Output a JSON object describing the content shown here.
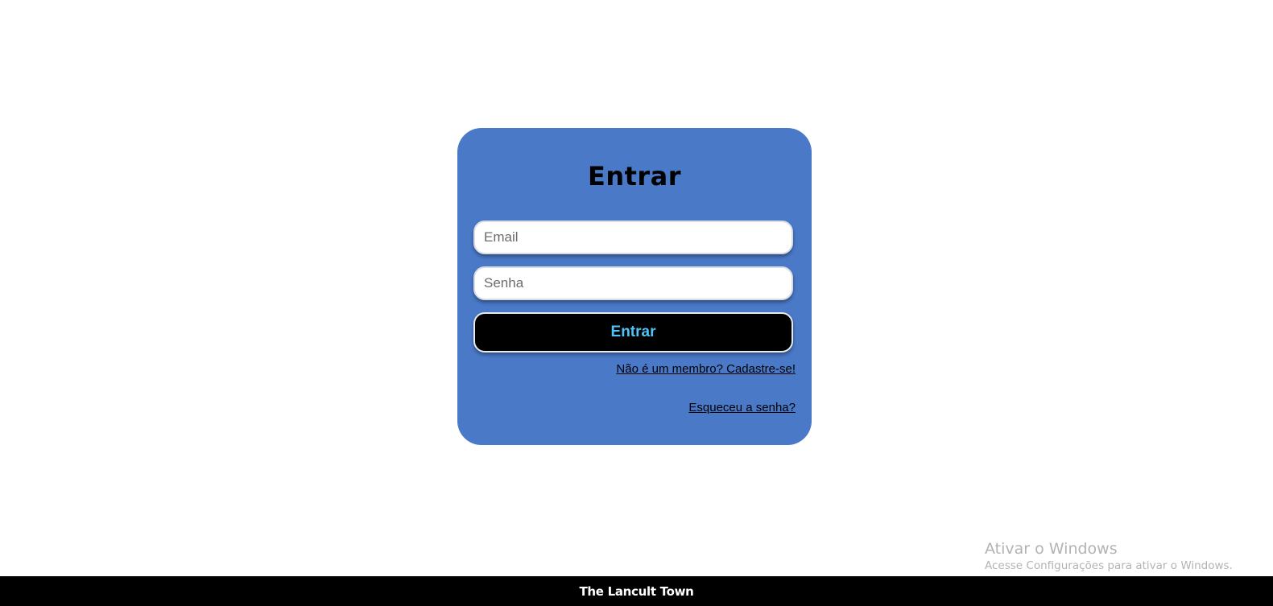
{
  "login": {
    "title": "Entrar",
    "email_placeholder": "Email",
    "password_placeholder": "Senha",
    "submit_label": "Entrar",
    "signup_link": "Não é um membro? Cadastre-se!",
    "forgot_link": "Esqueceu a senha?"
  },
  "footer": {
    "text": "The Lancult Town"
  },
  "watermark": {
    "title": "Ativar o Windows",
    "subtitle": "Acesse Configurações para ativar o Windows."
  },
  "colors": {
    "card_background": "#4a79c8",
    "button_background": "#000000",
    "button_text": "#4fc3f7",
    "footer_background": "#000000",
    "page_background": "#ffffff"
  }
}
